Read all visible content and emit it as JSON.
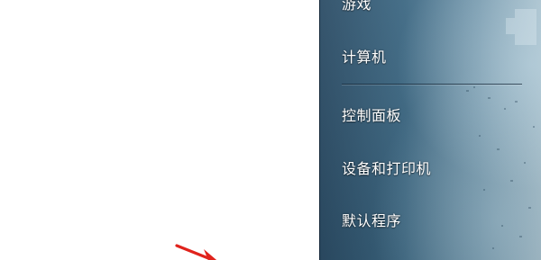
{
  "start_menu": {
    "right_pane": {
      "items": [
        {
          "label": "游戏"
        },
        {
          "label": "计算机"
        },
        {
          "label": "控制面板"
        },
        {
          "label": "设备和打印机"
        },
        {
          "label": "默认程序"
        }
      ]
    }
  },
  "annotation": {
    "arrow_color": "#e0231c"
  },
  "colors": {
    "pane_dark": "#2c4d66",
    "pane_light": "#a7bfcb",
    "menu_text": "#ffffff"
  }
}
